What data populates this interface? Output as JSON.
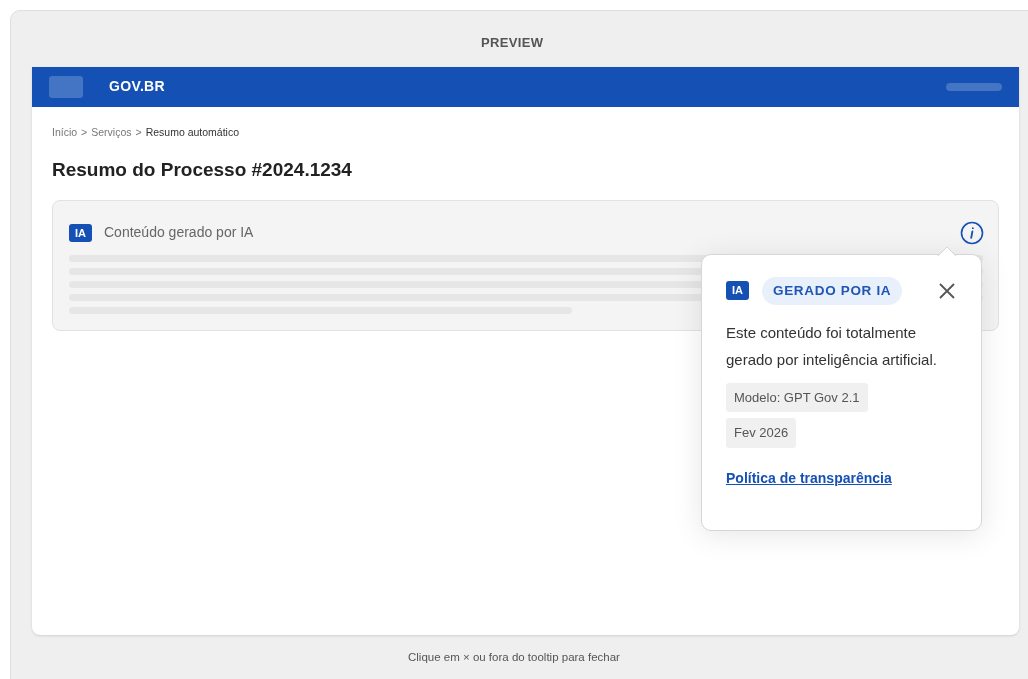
{
  "preview_title": "PREVIEW",
  "header": {
    "brand": "GOV.BR"
  },
  "breadcrumb": [
    {
      "label": "Início",
      "current": false
    },
    {
      "label": "Serviços",
      "current": false
    },
    {
      "label": "Resumo automático",
      "current": true
    }
  ],
  "breadcrumb_separator": ">",
  "page_title": "Resumo do Processo #2024.1234",
  "card": {
    "badge": "IA",
    "label": "Conteúdo gerado por IA"
  },
  "tooltip": {
    "open": true,
    "badge": "IA",
    "tag": "GERADO POR IA",
    "text": "Este conteúdo foi totalmente gerado por inteligência artificial.",
    "chips": [
      "Modelo: GPT Gov 2.1",
      "Fev 2026"
    ],
    "link": "Política de transparência"
  },
  "footer_hint": "Clique em × ou fora do tooltip para fechar"
}
